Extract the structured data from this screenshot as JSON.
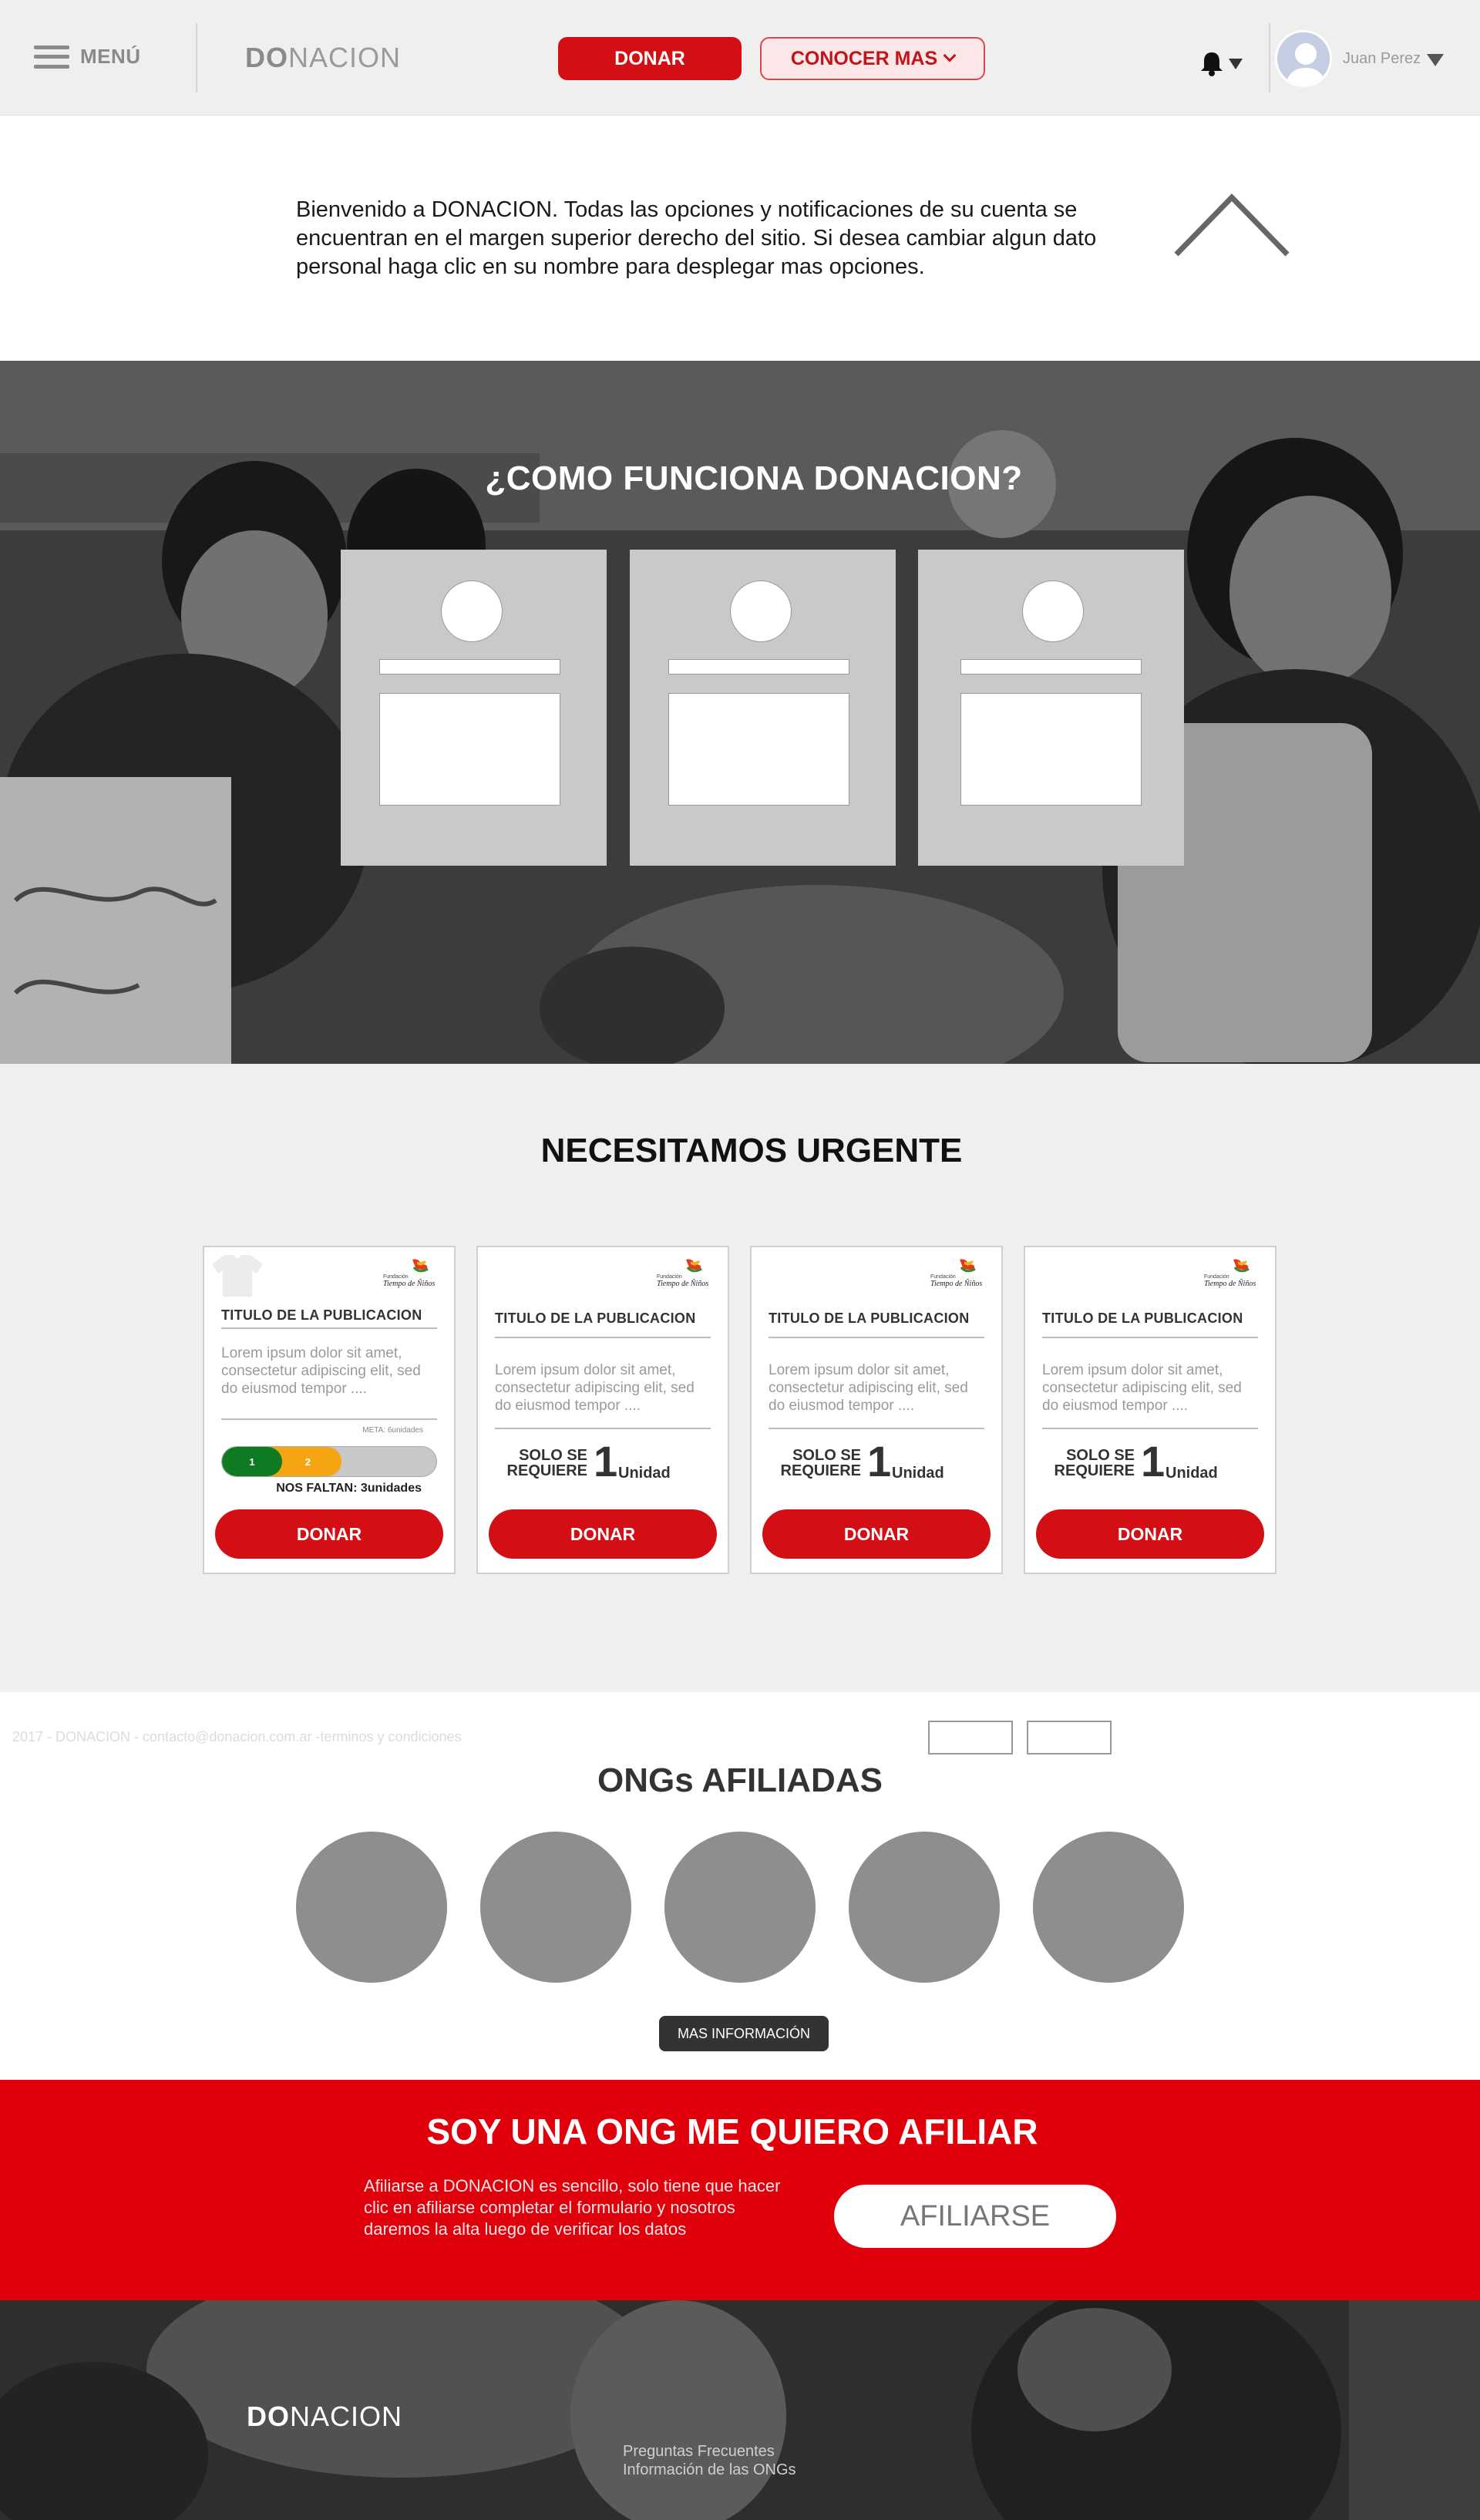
{
  "header": {
    "menu_label": "MENÚ",
    "logo_bold": "DO",
    "logo_rest": "NACION",
    "donar_label": "DONAR",
    "conocer_label": "CONOCER MAS",
    "user_name": "Juan Perez"
  },
  "welcome": {
    "text": "Bienvenido a DONACION. Todas las opciones y notificaciones de su cuenta se encuentran en el margen superior derecho del sitio. Si desea cambiar algun dato personal haga clic en su nombre para desplegar mas opciones."
  },
  "how": {
    "title": "¿COMO FUNCIONA DONACION?"
  },
  "urgent": {
    "title": "NECESITAMOS URGENTE",
    "cards": [
      {
        "title": "TITULO DE LA PUBLICACION",
        "desc": "Lorem ipsum dolor sit amet, consectetur adipiscing elit, sed do eiusmod tempor ....",
        "meta": "META: 6unidades",
        "progress_step1": "1",
        "progress_step2": "2",
        "progress_fraction": 0.5,
        "faltan": "NOS FALTAN: 3unidades",
        "button": "DONAR"
      },
      {
        "title": "TITULO DE LA PUBLICACION",
        "desc": "Lorem ipsum dolor sit amet, consectetur adipiscing elit, sed do eiusmod tempor ....",
        "solo": "SOLO SE REQUIERE",
        "qty": "1",
        "unit": "Unidad",
        "button": "DONAR"
      },
      {
        "title": "TITULO DE LA PUBLICACION",
        "desc": "Lorem ipsum dolor sit amet, consectetur adipiscing elit, sed do eiusmod tempor ....",
        "solo": "SOLO SE REQUIERE",
        "qty": "1",
        "unit": "Unidad",
        "button": "DONAR"
      },
      {
        "title": "TITULO DE LA PUBLICACION",
        "desc": "Lorem ipsum dolor sit amet, consectetur adipiscing elit, sed do eiusmod tempor ....",
        "solo": "SOLO SE REQUIERE",
        "qty": "1",
        "unit": "Unidad",
        "button": "DONAR"
      }
    ]
  },
  "ongs": {
    "copyright": "2017 - DONACION - contacto@donacion.com.ar -terminos y condiciones",
    "title": "ONGs AFILIADAS",
    "more_button": "MAS INFORMACIÓN"
  },
  "afiliar": {
    "title_bold": "SOY UNA ONG",
    "title_rest": " ME QUIERO AFILIAR",
    "text": "Afiliarse a DONACION es sencillo, solo tiene que hacer clic en afiliarse completar el formulario y nosotros daremos la alta luego de verificar los datos",
    "button": "AFILIARSE"
  },
  "footer": {
    "logo_bold": "DO",
    "logo_rest": "NACION",
    "links": [
      "Preguntas Frecuentes",
      "Información de las ONGs"
    ]
  },
  "colors": {
    "brand_red": "#d30e14",
    "afiliar_red": "#e0000b",
    "progress_green": "#0e7a22",
    "progress_orange": "#f4a511"
  }
}
